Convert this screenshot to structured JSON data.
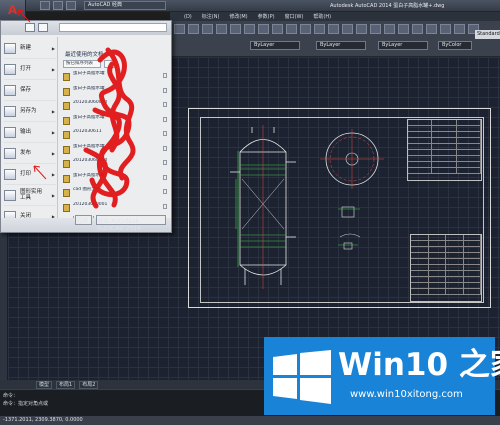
{
  "window": {
    "title": "Autodesk AutoCAD 2014    蛋白子高脂水罐+.dwg",
    "workspace": "AutoCAD 经典"
  },
  "menubar": {
    "items": [
      "(D)",
      "标注(N)",
      "修改(M)",
      "参数(P)",
      "窗口(W)",
      "帮助(H)"
    ]
  },
  "ribbon": {
    "layer_value": "ByLayer",
    "linetype_value": "ByLayer",
    "lineweight_value": "ByLayer",
    "plotstyle_value": "ByColor",
    "style_value": "Standard"
  },
  "app_menu": {
    "commands": [
      {
        "label": "新建",
        "has_submenu": true
      },
      {
        "label": "打开",
        "has_submenu": true
      },
      {
        "label": "保存",
        "has_submenu": false
      },
      {
        "label": "另存为",
        "has_submenu": true
      },
      {
        "label": "输出",
        "has_submenu": true
      },
      {
        "label": "发布",
        "has_submenu": true
      },
      {
        "label": "打印",
        "has_submenu": true
      },
      {
        "label": "图形实用工具",
        "has_submenu": true
      },
      {
        "label": "关闭",
        "has_submenu": true
      }
    ],
    "recent_title": "最近使用的文档",
    "filter_label": "按已排序列表",
    "recent_files": [
      "蛋白子高脂水罐",
      "蛋白子高脂水罐",
      "201203060000",
      "蛋白子高脂水罐",
      "2012030611",
      "蛋白子高脂水罐",
      "201203060000",
      "蛋白子高脂水罐",
      "cad 图形文件",
      "201203060001",
      "Drawing1.dwg"
    ],
    "options_button": "选项",
    "exit_button": "退出 Autodesk AutoCAD 2014"
  },
  "layout_tabs": [
    "模型",
    "布局1",
    "布局2"
  ],
  "command_line": {
    "lines": [
      "命令：",
      "命令：指定对角点或"
    ],
    "status_coords": "-1371.2011, 2309.3870, 0.0000"
  },
  "watermark": {
    "brand": "Win10 之家",
    "url": "www.win10xitong.com",
    "color": "#1883d7"
  },
  "colors": {
    "accent_red": "#e0302a",
    "menu_bg": "#ecedef",
    "canvas_bg": "#1d2230"
  }
}
